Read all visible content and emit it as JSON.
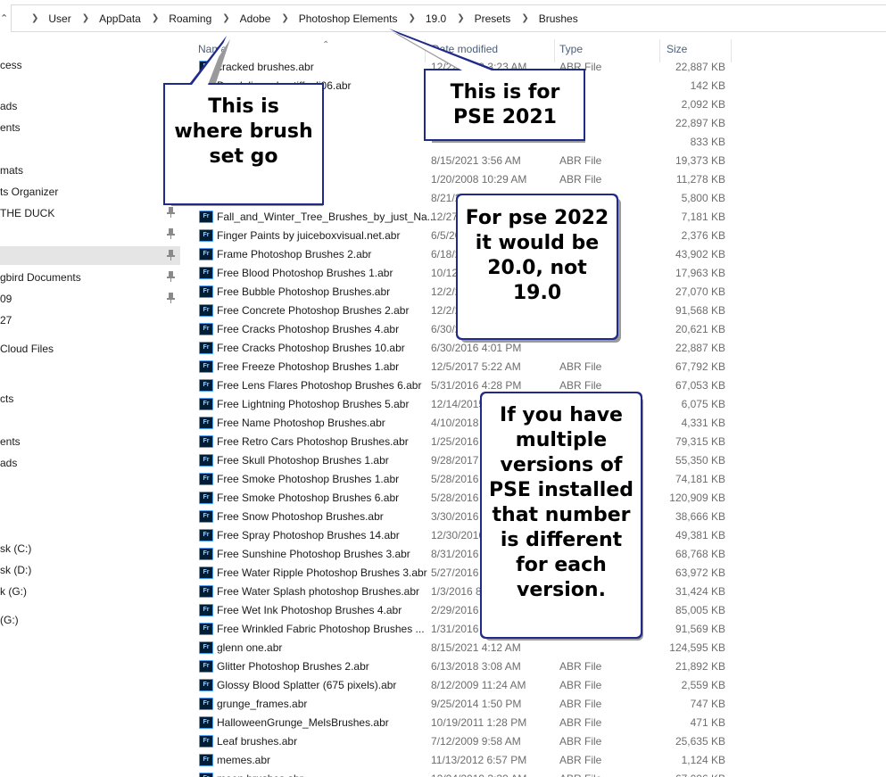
{
  "address_bar": {
    "crumbs": [
      "User",
      "AppData",
      "Roaming",
      "Adobe",
      "Photoshop Elements",
      "19.0",
      "Presets",
      "Brushes"
    ]
  },
  "sidebar": {
    "items": [
      {
        "label": "cess",
        "pinned": false,
        "selected": false
      },
      {
        "label": "",
        "pinned": false,
        "selected": false
      },
      {
        "label": "ads",
        "pinned": false,
        "selected": false
      },
      {
        "label": "ents",
        "pinned": false,
        "selected": false
      },
      {
        "label": "",
        "pinned": false,
        "selected": false
      },
      {
        "label": "mats",
        "pinned": false,
        "selected": false
      },
      {
        "label": "ts Organizer",
        "pinned": false,
        "selected": false
      },
      {
        "label": "THE DUCK",
        "pinned": true,
        "selected": false
      },
      {
        "label": "",
        "pinned": true,
        "selected": false
      },
      {
        "label": "",
        "pinned": true,
        "selected": true
      },
      {
        "label": "gbird Documents",
        "pinned": true,
        "selected": false
      },
      {
        "label": "09",
        "pinned": true,
        "selected": false
      },
      {
        "label": "27",
        "pinned": false,
        "selected": false
      },
      {
        "label": "Cloud Files",
        "pinned": false,
        "selected": false
      },
      {
        "label": "cts",
        "pinned": false,
        "selected": false
      },
      {
        "label": "ents",
        "pinned": false,
        "selected": false
      },
      {
        "label": "ads",
        "pinned": false,
        "selected": false
      },
      {
        "label": "sk (C:)",
        "pinned": false,
        "selected": false
      },
      {
        "label": "sk (D:)",
        "pinned": false,
        "selected": false
      },
      {
        "label": "k (G:)",
        "pinned": false,
        "selected": false
      },
      {
        "label": "(G:)",
        "pinned": false,
        "selected": false
      }
    ]
  },
  "columns": {
    "name": "Name",
    "date": "Date modified",
    "type": "Type",
    "size": "Size"
  },
  "files": [
    {
      "name": "cracked brushes.abr",
      "date": "12/22/2019 3:23 AM",
      "type": "ABR File",
      "size": "22,887 KB"
    },
    {
      "name": "Dandelions_by_tiffcali06.abr",
      "date": "",
      "type": "",
      "size": "142 KB"
    },
    {
      "name": "",
      "date": "",
      "type": "",
      "size": "2,092 KB"
    },
    {
      "name": "",
      "date": "",
      "type": "",
      "size": "22,897 KB"
    },
    {
      "name": "",
      "date": "",
      "type": "",
      "size": "833 KB"
    },
    {
      "name": "",
      "date": "8/15/2021 3:56 AM",
      "type": "ABR File",
      "size": "19,373 KB"
    },
    {
      "name": "",
      "date": "1/20/2008 10:29 AM",
      "type": "ABR File",
      "size": "11,278 KB"
    },
    {
      "name": "",
      "date": "8/21/2019 4:50 AM",
      "type": "ABR File",
      "size": "5,800 KB"
    },
    {
      "name": "Fall_and_Winter_Tree_Brushes_by_just_Na...",
      "date": "12/27",
      "type": "",
      "size": "7,181 KB"
    },
    {
      "name": "Finger Paints by juiceboxvisual.net.abr",
      "date": "6/5/20",
      "type": "",
      "size": "2,376 KB"
    },
    {
      "name": "Frame Photoshop Brushes 2.abr",
      "date": "6/18/2",
      "type": "",
      "size": "43,902 KB"
    },
    {
      "name": "Free Blood Photoshop Brushes 1.abr",
      "date": "10/12/",
      "type": "",
      "size": "17,963 KB"
    },
    {
      "name": "Free Bubble Photoshop Brushes.abr",
      "date": "12/2/2",
      "type": "",
      "size": "27,070 KB"
    },
    {
      "name": "Free Concrete Photoshop Brushes 2.abr",
      "date": "12/2/2",
      "type": "",
      "size": "91,568 KB"
    },
    {
      "name": "Free Cracks Photoshop Brushes 4.abr",
      "date": "6/30/2",
      "type": "",
      "size": "20,621 KB"
    },
    {
      "name": "Free Cracks Photoshop Brushes 10.abr",
      "date": "6/30/2016 4:01 PM",
      "type": "",
      "size": "22,887 KB"
    },
    {
      "name": "Free Freeze Photoshop Brushes 1.abr",
      "date": "12/5/2017 5:22 AM",
      "type": "ABR File",
      "size": "67,792 KB"
    },
    {
      "name": "Free Lens Flares Photoshop Brushes 6.abr",
      "date": "5/31/2016 4:28 PM",
      "type": "ABR File",
      "size": "67,053 KB"
    },
    {
      "name": "Free Lightning Photoshop Brushes 5.abr",
      "date": "12/14/2015",
      "type": "",
      "size": "6,075 KB"
    },
    {
      "name": "Free Name Photoshop Brushes.abr",
      "date": "4/10/2018",
      "type": "",
      "size": "4,331 KB"
    },
    {
      "name": "Free Retro Cars Photoshop Brushes.abr",
      "date": "1/25/2016",
      "type": "",
      "size": "79,315 KB"
    },
    {
      "name": "Free Skull Photoshop Brushes 1.abr",
      "date": "9/28/2017",
      "type": "",
      "size": "55,350 KB"
    },
    {
      "name": "Free Smoke Photoshop Brushes 1.abr",
      "date": "5/28/2016",
      "type": "",
      "size": "74,181 KB"
    },
    {
      "name": "Free Smoke Photoshop Brushes 6.abr",
      "date": "5/28/2016",
      "type": "",
      "size": "120,909 KB"
    },
    {
      "name": "Free Snow Photoshop Brushes.abr",
      "date": "3/30/2016",
      "type": "",
      "size": "38,666 KB"
    },
    {
      "name": "Free Spray Photoshop Brushes 14.abr",
      "date": "12/30/2016",
      "type": "",
      "size": "49,381 KB"
    },
    {
      "name": "Free Sunshine Photoshop Brushes 3.abr",
      "date": "8/31/2016",
      "type": "",
      "size": "68,768 KB"
    },
    {
      "name": "Free Water Ripple Photoshop Brushes 3.abr",
      "date": "5/27/2016",
      "type": "",
      "size": "63,972 KB"
    },
    {
      "name": "Free Water Splash photoshop Brushes.abr",
      "date": "1/3/2016 8",
      "type": "",
      "size": "31,424 KB"
    },
    {
      "name": "Free Wet Ink Photoshop Brushes 4.abr",
      "date": "2/29/2016",
      "type": "",
      "size": "85,005 KB"
    },
    {
      "name": "Free Wrinkled Fabric Photoshop Brushes ...",
      "date": "1/31/2016",
      "type": "",
      "size": "91,569 KB"
    },
    {
      "name": "glenn one.abr",
      "date": "8/15/2021 4:12 AM",
      "type": "",
      "size": "124,595 KB"
    },
    {
      "name": "Glitter Photoshop Brushes 2.abr",
      "date": "6/13/2018 3:08 AM",
      "type": "ABR File",
      "size": "21,892 KB"
    },
    {
      "name": "Glossy Blood Splatter (675 pixels).abr",
      "date": "8/12/2009 11:24 AM",
      "type": "ABR File",
      "size": "2,559 KB"
    },
    {
      "name": "grunge_frames.abr",
      "date": "9/25/2014 1:50 PM",
      "type": "ABR File",
      "size": "747 KB"
    },
    {
      "name": "HalloweenGrunge_MelsBrushes.abr",
      "date": "10/19/2011 1:28 PM",
      "type": "ABR File",
      "size": "471 KB"
    },
    {
      "name": "Leaf brushes.abr",
      "date": "7/12/2009 9:58 AM",
      "type": "ABR File",
      "size": "25,635 KB"
    },
    {
      "name": "memes.abr",
      "date": "11/13/2012 6:57 PM",
      "type": "ABR File",
      "size": "1,124 KB"
    },
    {
      "name": "moon brushes.abr",
      "date": "12/24/2019 3:39 AM",
      "type": "ABR File",
      "size": "67,006 KB"
    }
  ],
  "callouts": {
    "brush_set": "This is where brush set go",
    "pse2021": "This is for PSE 2021",
    "pse2022": "For pse 2022 it would be 20.0, not 19.0",
    "multiple": "If you have multiple versions of PSE installed that number is different for each version."
  },
  "file_icon_label": "Fr"
}
